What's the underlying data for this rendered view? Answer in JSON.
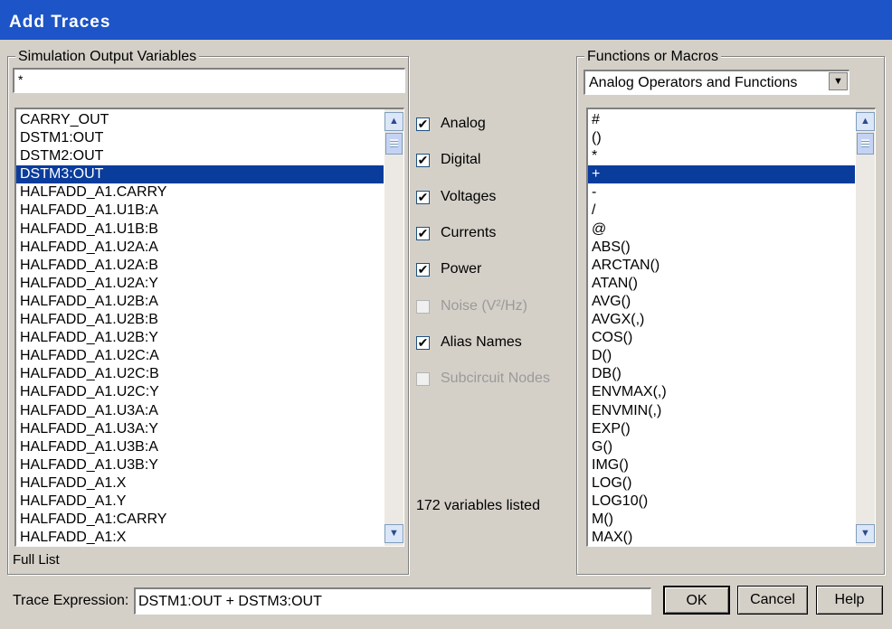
{
  "window": {
    "title": "Add Traces"
  },
  "left_group": {
    "legend": "Simulation Output Variables",
    "filter_value": "*",
    "items": [
      "CARRY_OUT",
      "DSTM1:OUT",
      "DSTM2:OUT",
      "DSTM3:OUT",
      "HALFADD_A1.CARRY",
      "HALFADD_A1.U1B:A",
      "HALFADD_A1.U1B:B",
      "HALFADD_A1.U2A:A",
      "HALFADD_A1.U2A:B",
      "HALFADD_A1.U2A:Y",
      "HALFADD_A1.U2B:A",
      "HALFADD_A1.U2B:B",
      "HALFADD_A1.U2B:Y",
      "HALFADD_A1.U2C:A",
      "HALFADD_A1.U2C:B",
      "HALFADD_A1.U2C:Y",
      "HALFADD_A1.U3A:A",
      "HALFADD_A1.U3A:Y",
      "HALFADD_A1.U3B:A",
      "HALFADD_A1.U3B:Y",
      "HALFADD_A1.X",
      "HALFADD_A1.Y",
      "HALFADD_A1:CARRY",
      "HALFADD_A1:X"
    ],
    "selected": "DSTM3:OUT",
    "full_list_label": "Full List"
  },
  "filters": [
    {
      "label": "Analog",
      "checked": true,
      "enabled": true
    },
    {
      "label": "Digital",
      "checked": true,
      "enabled": true
    },
    {
      "label": "Voltages",
      "checked": true,
      "enabled": true
    },
    {
      "label": "Currents",
      "checked": true,
      "enabled": true
    },
    {
      "label": "Power",
      "checked": true,
      "enabled": true
    },
    {
      "label": "Noise (V²/Hz)",
      "checked": false,
      "enabled": false
    },
    {
      "label": "Alias Names",
      "checked": true,
      "enabled": true
    },
    {
      "label": "Subcircuit Nodes",
      "checked": false,
      "enabled": false
    }
  ],
  "status": "172 variables listed",
  "right_group": {
    "legend": "Functions or Macros",
    "selected_option": "Analog Operators and Functions",
    "items": [
      "#",
      "()",
      "*",
      "+",
      "-",
      "/",
      "@",
      "ABS()",
      "ARCTAN()",
      "ATAN()",
      "AVG()",
      "AVGX(,)",
      "COS()",
      "D()",
      "DB()",
      "ENVMAX(,)",
      "ENVMIN(,)",
      "EXP()",
      "G()",
      "IMG()",
      "LOG()",
      "LOG10()",
      "M()",
      "MAX()"
    ],
    "selected": "+"
  },
  "trace_expression": {
    "label": "Trace Expression:",
    "value": "DSTM1:OUT + DSTM3:OUT"
  },
  "buttons": {
    "ok": "OK",
    "cancel": "Cancel",
    "help": "Help"
  },
  "icons": {
    "scroll_up": "scroll-up-arrow-icon",
    "scroll_down": "scroll-down-arrow-icon",
    "dropdown": "chevron-down-icon",
    "check": "checkmark-icon"
  },
  "colors": {
    "title_bar": "#1d54c7",
    "selection": "#0a3c9c",
    "dialog_bg": "#d4d0c8"
  }
}
